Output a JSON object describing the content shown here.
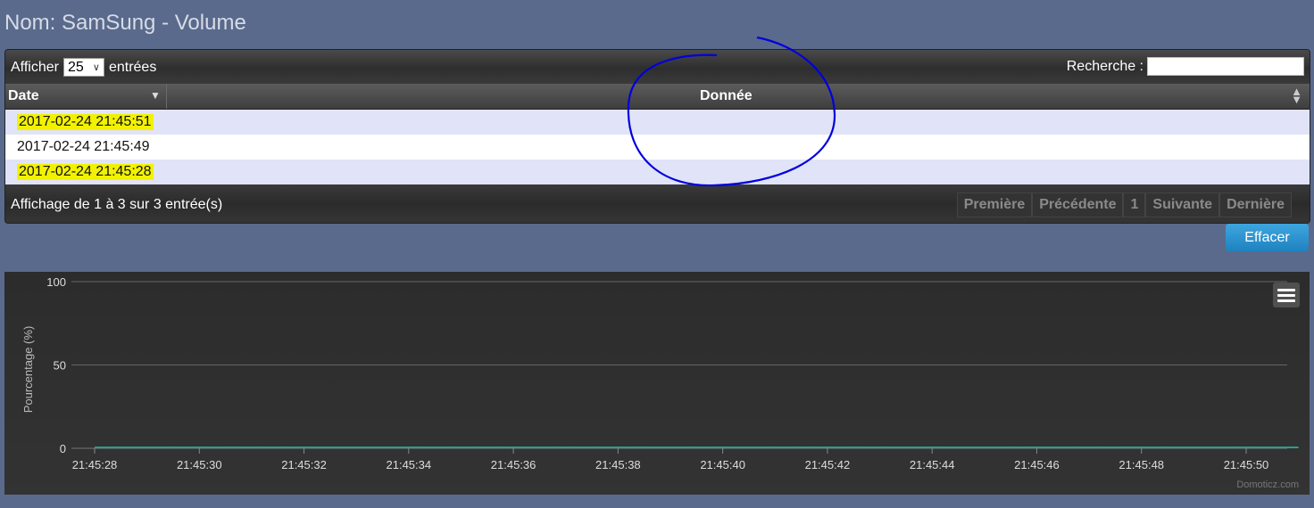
{
  "title": "Nom: SamSung - Volume",
  "controls": {
    "show_label": "Afficher",
    "page_size": "25",
    "entries_label": "entrées",
    "search_label": "Recherche :",
    "search_value": ""
  },
  "table": {
    "columns": [
      "Date",
      "Donnée"
    ],
    "rows": [
      {
        "date": "2017-02-24 21:45:51",
        "value": ""
      },
      {
        "date": "2017-02-24 21:45:49",
        "value": ""
      },
      {
        "date": "2017-02-24 21:45:28",
        "value": ""
      }
    ],
    "info": "Affichage de 1 à 3 sur 3 entrée(s)"
  },
  "pager": {
    "first": "Première",
    "previous": "Précédente",
    "current": "1",
    "next": "Suivante",
    "last": "Dernière"
  },
  "clear_button": "Effacer",
  "colors": {
    "background": "#5a6a8c",
    "series": "#2a9d8f",
    "highlight": "#f2f200",
    "annotation": "#0000dd"
  },
  "chart_data": {
    "type": "line",
    "title": "",
    "xlabel": "",
    "ylabel": "Pourcentage  (%)",
    "ylim": [
      0,
      100
    ],
    "yticks": [
      "100",
      "50",
      "0"
    ],
    "xticks": [
      "21:45:28",
      "21:45:30",
      "21:45:32",
      "21:45:34",
      "21:45:36",
      "21:45:38",
      "21:45:40",
      "21:45:42",
      "21:45:44",
      "21:45:46",
      "21:45:48",
      "21:45:50"
    ],
    "series": [
      {
        "x": [
          "21:45:28",
          "21:45:49",
          "21:45:51"
        ],
        "values": [
          0,
          0,
          0
        ]
      }
    ],
    "grid": true,
    "credit": "Domoticz.com"
  }
}
